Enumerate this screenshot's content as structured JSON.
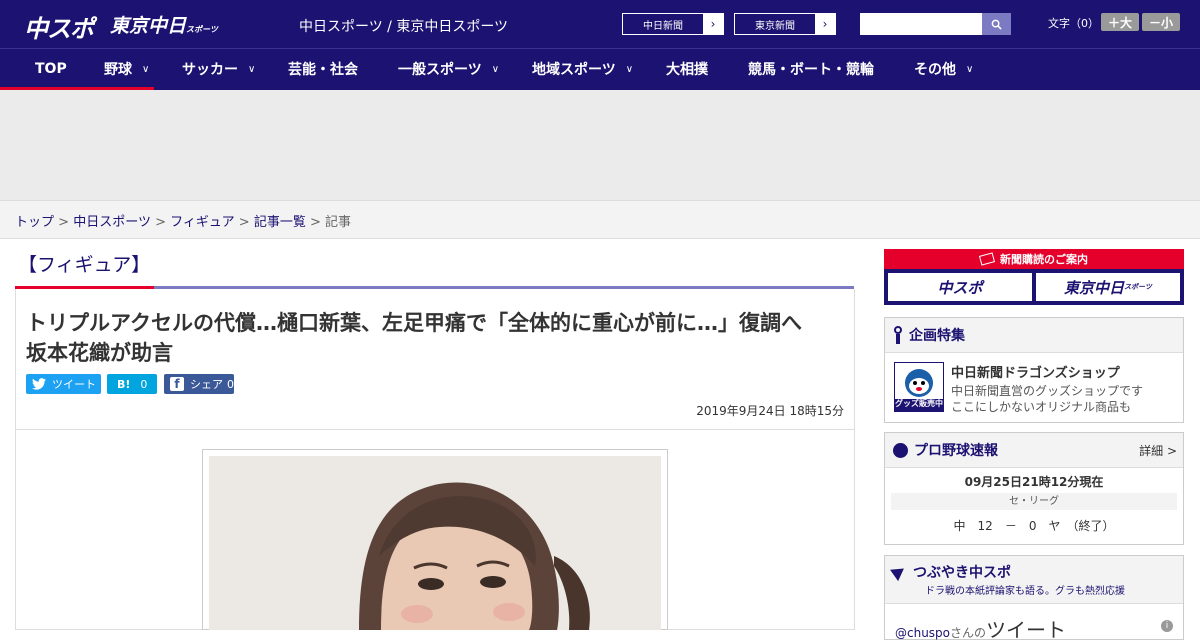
{
  "header": {
    "logo": "中スポ",
    "logo2": "東京中日",
    "logo2_small": "スポーツ",
    "tagline": "中日スポーツ / 東京中日スポーツ",
    "paper_links": [
      "中日新聞",
      "東京新聞"
    ],
    "font_label": "文字（0）",
    "font_larger": "＋大",
    "font_smaller": "－小",
    "search_icon": "search-icon"
  },
  "nav": {
    "items": [
      {
        "label": "TOP"
      },
      {
        "label": "野球",
        "chevron": "∨"
      },
      {
        "label": "サッカー",
        "chevron": "∨"
      },
      {
        "label": "芸能・社会"
      },
      {
        "label": "一般スポーツ",
        "chevron": "∨"
      },
      {
        "label": "地域スポーツ",
        "chevron": "∨"
      },
      {
        "label": "大相撲"
      },
      {
        "label": "競馬・ボート・競輪"
      },
      {
        "label": "その他",
        "chevron": "∨"
      }
    ]
  },
  "breadcrumb": {
    "items": [
      "トップ",
      "中日スポーツ",
      "フィギュア",
      "記事一覧"
    ],
    "separator": ">",
    "current": "記事"
  },
  "article": {
    "category": "【フィギュア】",
    "headline_line1": "トリプルアクセルの代償…樋口新葉、左足甲痛で「全体的に重心が前に…」復調へ",
    "headline_line2": "坂本花織が助言",
    "share": {
      "tweet": "ツイート",
      "hatena": "B!",
      "hatena_count": "0",
      "share": "シェア",
      "share_count": "0"
    },
    "date": "2019年9月24日 18時15分"
  },
  "sidebar": {
    "subscription_title": "新聞購読のご案内",
    "subscription_buttons": [
      "中スポ",
      "東京中日"
    ],
    "subscription_small": "スポーツ",
    "feature": {
      "title": "企画特集",
      "item_title": "中日新聞ドラゴンズショップ",
      "item_desc1": "中日新聞直営のグッズショップです",
      "item_desc2": "ここにしかないオリジナル商品も",
      "image_badge": "グッズ販売中"
    },
    "baseball": {
      "title": "プロ野球速報",
      "detail": "詳細 >",
      "updated": "09月25日21時12分現在",
      "league": "セ・リーグ",
      "score": "中　12　－　0　ヤ　（終了）"
    },
    "tweets": {
      "title": "つぶやき中スポ",
      "subtitle": "ドラ戦の本紙評論家も語る。グラも熱烈応援",
      "handle": "@chuspo",
      "handle_suffix": "さんの",
      "heading": "ツイート"
    }
  },
  "colors": {
    "brand": "#1b1271",
    "accent": "#e4002b",
    "twitter": "#1da1f2",
    "hatena": "#00a4de",
    "facebook": "#3b5998"
  }
}
